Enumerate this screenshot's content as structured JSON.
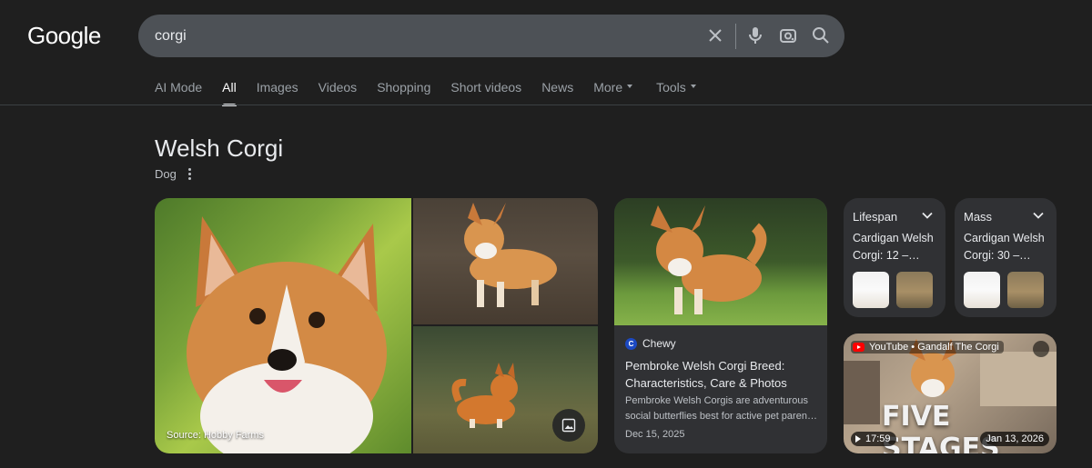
{
  "logo": {
    "text": "Google"
  },
  "search": {
    "query": "corgi"
  },
  "tabs": [
    {
      "label": "AI Mode"
    },
    {
      "label": "All"
    },
    {
      "label": "Images"
    },
    {
      "label": "Videos"
    },
    {
      "label": "Shopping"
    },
    {
      "label": "Short videos"
    },
    {
      "label": "News"
    },
    {
      "label": "More"
    },
    {
      "label": "Tools"
    }
  ],
  "knowledge": {
    "title": "Welsh Corgi",
    "subtitle": "Dog",
    "gallery": {
      "source": "Source: Hobby Farms"
    },
    "article": {
      "source": "Chewy",
      "title": "Pembroke Welsh Corgi Breed: Characteristics, Care & Photos",
      "description": "Pembroke Welsh Corgis are adventurous social butterflies best for active pet paren…",
      "date": "Dec 15, 2025"
    },
    "facts": [
      {
        "label": "Lifespan",
        "value": "Cardigan Welsh Corgi: 12 –…"
      },
      {
        "label": "Mass",
        "value": "Cardigan Welsh Corgi: 30 –…"
      }
    ],
    "video": {
      "source": "YouTube • Gandalf The Corgi",
      "caption": "FIVE STAGES",
      "duration": "17:59",
      "date": "Jan 13, 2026"
    }
  },
  "colors": {
    "background": "#1f1f1f",
    "search_bg": "#4d5156",
    "card_bg": "#303134"
  }
}
